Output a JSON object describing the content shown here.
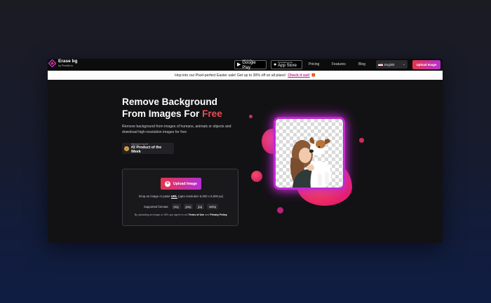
{
  "brand": {
    "name": "Erase bg",
    "byline": "by Pixelbin.io"
  },
  "nav": {
    "google_play": {
      "small": "GET IT ON",
      "big": "Google Play"
    },
    "app_store": {
      "small": "Download on the",
      "big": "App Store"
    },
    "links": [
      "Pricing",
      "Features",
      "Blog"
    ],
    "language": "English",
    "upload_label": "Upload Image"
  },
  "banner": {
    "text": "Hop into our Pixel-perfect Easter sale! Get up to 30% off on all plans!",
    "cta": "Check it out!"
  },
  "hero": {
    "title_line1": "Remove Background",
    "title_line2_prefix": "From Images For ",
    "title_accent": "Free",
    "subtitle": "Remove background from images of humans, animals or objects and download high-resolution images for free",
    "badge": {
      "small": "PRODUCT HUNT",
      "big": "#2 Product of the Week"
    }
  },
  "upload_card": {
    "button_label": "Upload Image",
    "drop_prefix": "Drop an image or paste ",
    "drop_url": "URL",
    "drop_suffix": " (upto resolution 5,000 x 5,000 px)",
    "formats_label": "Supported formats:",
    "formats": [
      "png",
      "jpeg",
      "jpg",
      "webp"
    ],
    "terms_prefix": "By uploading an image or URL you agree to our ",
    "terms_link": "Terms of Use",
    "terms_mid": " and ",
    "privacy_link": "Privacy Policy."
  },
  "colors": {
    "accent_start": "#e8344a",
    "accent_end": "#b62ed6",
    "frame_glow": "#c12ad0",
    "title_accent": "#f04a55"
  }
}
